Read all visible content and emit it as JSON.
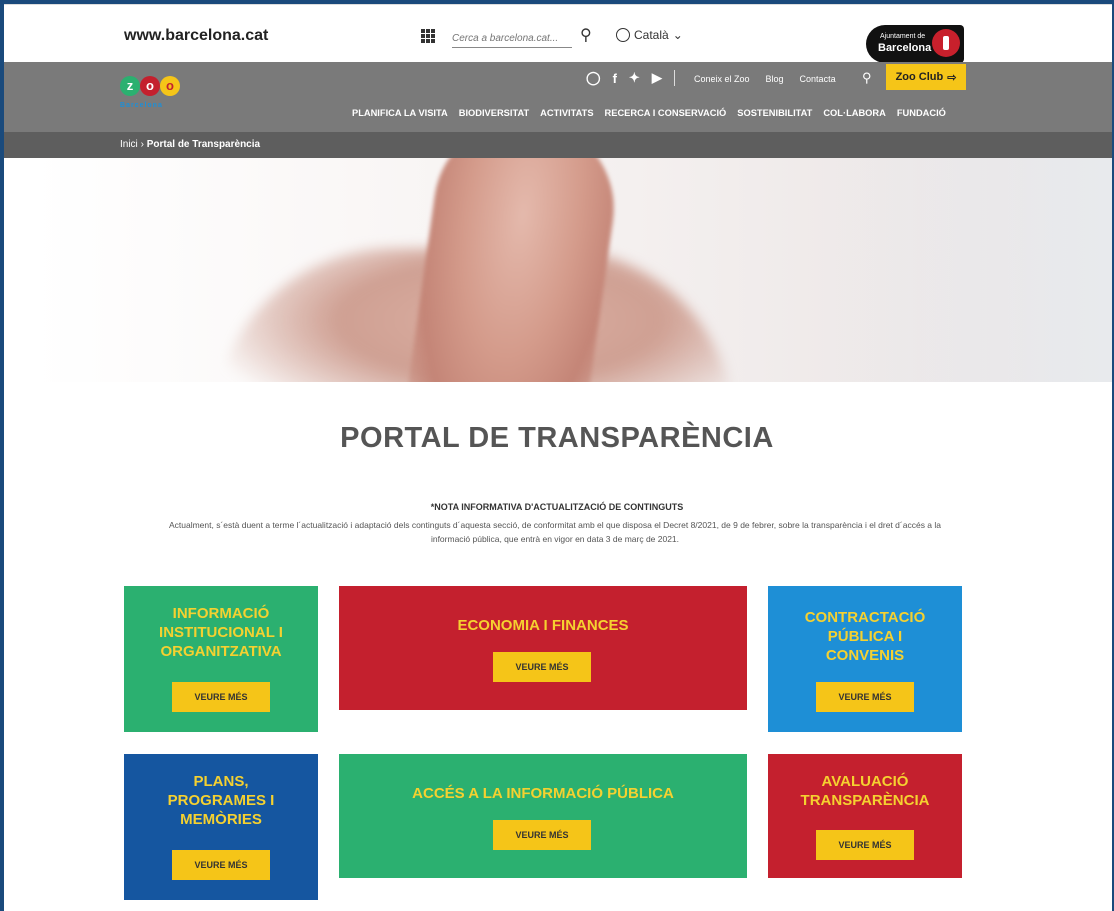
{
  "bcn_bar": {
    "url": "www.barcelona.cat",
    "search_placeholder": "Cerca a barcelona.cat...",
    "language": "Català",
    "ajuntament_small": "Ajuntament de",
    "ajuntament_big": "Barcelona"
  },
  "zoo_header": {
    "logo_letters": [
      "z",
      "o",
      "o"
    ],
    "logo_word": "Barcelona",
    "social_icons": [
      "instagram-icon",
      "facebook-icon",
      "twitter-icon",
      "youtube-icon"
    ],
    "top_links": [
      "Coneix el Zoo",
      "Blog",
      "Contacta"
    ],
    "zoo_club": "Zoo Club",
    "nav": [
      "PLANIFICA LA VISITA",
      "BIODIVERSITAT",
      "ACTIVITATS",
      "RECERCA I CONSERVACIÓ",
      "SOSTENIBILITAT",
      "COL·LABORA",
      "FUNDACIÓ"
    ]
  },
  "breadcrumb": {
    "home": "Inici",
    "separator": "›",
    "current": "Portal de Transparència"
  },
  "main": {
    "title": "PORTAL DE TRANSPARÈNCIA",
    "note_title": "*NOTA INFORMATIVA D'ACTUALITZACIÓ DE CONTINGUTS",
    "note_text": "Actualment, s´està duent a terme l´actualització i adaptació dels continguts d´aquesta secció, de conformitat amb el que disposa el Decret 8/2021, de 9 de febrer, sobre la transparència i el dret d´accés a la informació pública, que entrà en vigor en data 3 de març de 2021."
  },
  "cards": [
    {
      "title": "INFORMACIÓ INSTITUCIONAL I ORGANITZATIVA",
      "button": "VEURE MÉS",
      "color": "#2bb070"
    },
    {
      "title": "ECONOMIA I FINANCES",
      "button": "VEURE MÉS",
      "color": "#c4202e"
    },
    {
      "title": "CONTRACTACIÓ PÚBLICA I CONVENIS",
      "button": "VEURE MÉS",
      "color": "#1e8fd6"
    },
    {
      "title": "PLANS, PROGRAMES I MEMÒRIES",
      "button": "VEURE MÉS",
      "color": "#1556a0"
    },
    {
      "title": "ACCÉS A LA INFORMACIÓ PÚBLICA",
      "button": "VEURE MÉS",
      "color": "#2bb070"
    },
    {
      "title": "AVALUACIÓ TRANSPARÈNCIA",
      "button": "VEURE MÉS",
      "color": "#c4202e"
    }
  ],
  "colors": {
    "header_gray": "#7a7a7a",
    "breadcrumb_gray": "#5e5e5e",
    "accent_yellow": "#f5c518"
  }
}
